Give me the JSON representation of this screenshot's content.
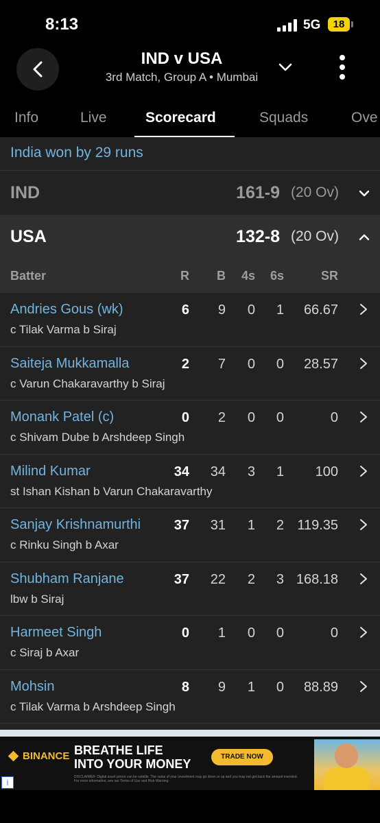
{
  "status_bar": {
    "time": "8:13",
    "network": "5G",
    "battery": "18"
  },
  "header": {
    "title": "IND v USA",
    "subtitle": "3rd Match, Group A • Mumbai"
  },
  "tabs": [
    {
      "label": "Info",
      "active": false
    },
    {
      "label": "Live",
      "active": false
    },
    {
      "label": "Scorecard",
      "active": true
    },
    {
      "label": "Squads",
      "active": false
    },
    {
      "label": "Ove",
      "active": false
    }
  ],
  "result": "India won by 29 runs",
  "innings": [
    {
      "team": "IND",
      "score": "161-9",
      "overs": "(20 Ov)",
      "expanded": false
    },
    {
      "team": "USA",
      "score": "132-8",
      "overs": "(20 Ov)",
      "expanded": true
    }
  ],
  "batting_columns": {
    "batter": "Batter",
    "r": "R",
    "b": "B",
    "fours": "4s",
    "sixes": "6s",
    "sr": "SR"
  },
  "batters": [
    {
      "name": "Andries Gous (wk)",
      "dismissal": "c Tilak Varma b Siraj",
      "r": "6",
      "b": "9",
      "fours": "0",
      "sixes": "1",
      "sr": "66.67"
    },
    {
      "name": "Saiteja Mukkamalla",
      "dismissal": "c Varun Chakaravarthy b Siraj",
      "r": "2",
      "b": "7",
      "fours": "0",
      "sixes": "0",
      "sr": "28.57"
    },
    {
      "name": "Monank Patel (c)",
      "dismissal": "c Shivam Dube b Arshdeep Singh",
      "r": "0",
      "b": "2",
      "fours": "0",
      "sixes": "0",
      "sr": "0"
    },
    {
      "name": "Milind Kumar",
      "dismissal": "st Ishan Kishan b Varun Chakaravarthy",
      "r": "34",
      "b": "34",
      "fours": "3",
      "sixes": "1",
      "sr": "100"
    },
    {
      "name": "Sanjay Krishnamurthi",
      "dismissal": "c Rinku Singh b Axar",
      "r": "37",
      "b": "31",
      "fours": "1",
      "sixes": "2",
      "sr": "119.35"
    },
    {
      "name": "Shubham Ranjane",
      "dismissal": "lbw b Siraj",
      "r": "37",
      "b": "22",
      "fours": "2",
      "sixes": "3",
      "sr": "168.18"
    },
    {
      "name": "Harmeet Singh",
      "dismissal": "c Siraj b Axar",
      "r": "0",
      "b": "1",
      "fours": "0",
      "sixes": "0",
      "sr": "0"
    },
    {
      "name": "Mohsin",
      "dismissal": "c Tilak Varma b Arshdeep Singh",
      "r": "8",
      "b": "9",
      "fours": "1",
      "sixes": "0",
      "sr": "88.89"
    }
  ],
  "ad": {
    "brand": "BINANCE",
    "headline_1": "BREATHE LIFE",
    "headline_2": "INTO YOUR MONEY",
    "cta": "TRADE NOW",
    "disclaimer": "DISCLAIMER: Digital asset prices can be volatile. The value of your investment may go down or up and you may not get back the amount invested. For more information, see our Terms of Use and Risk Warning."
  },
  "colors": {
    "link": "#72b4e0",
    "accent": "#f3ba2f",
    "battery": "#f4d20a"
  }
}
